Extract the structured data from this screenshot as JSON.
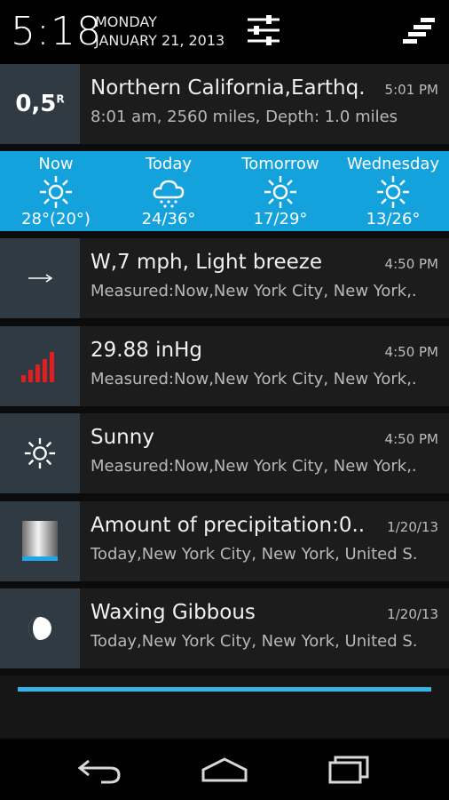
{
  "status": {
    "time": "5:18",
    "day": "MONDAY",
    "date": "JANUARY 21, 2013",
    "settings_icon": "sliders-icon",
    "clear_icon": "clear-all-icon"
  },
  "notifications": [
    {
      "icon": "earthquake-magnitude-icon",
      "icon_text": "0,5",
      "icon_sup": "R",
      "title": "Northern California,Earthq.",
      "time": "5:01 PM",
      "subtitle": "8:01 am, 2560 miles, Depth: 1.0 miles"
    },
    {
      "icon": "wind-arrow-icon",
      "title": "W,7 mph, Light breeze",
      "time": "4:50 PM",
      "subtitle": "Measured:Now,New York City, New York,."
    },
    {
      "icon": "pressure-bars-icon",
      "title": "29.88 inHg",
      "time": "4:50 PM",
      "subtitle": "Measured:Now,New York City, New York,."
    },
    {
      "icon": "sun-icon",
      "title": "Sunny",
      "time": "4:50 PM",
      "subtitle": "Measured:Now,New York City, New York,."
    },
    {
      "icon": "precipitation-gauge-icon",
      "title": "Amount of precipitation:0..",
      "time": "1/20/13",
      "subtitle": "Today,New York City, New York, United S."
    },
    {
      "icon": "moon-phase-icon",
      "title": "Waxing Gibbous",
      "time": "1/20/13",
      "subtitle": "Today,New York City, New York, United S."
    }
  ],
  "forecast": [
    {
      "label": "Now",
      "icon": "sun-icon",
      "temp": "28°(20°)"
    },
    {
      "label": "Today",
      "icon": "snow-cloud-icon",
      "temp": "24/36°"
    },
    {
      "label": "Tomorrow",
      "icon": "sun-icon",
      "temp": "17/29°"
    },
    {
      "label": "Wednesday",
      "icon": "sun-icon",
      "temp": "13/26°"
    }
  ],
  "colors": {
    "accent": "#14a2dd",
    "scrollbar": "#33b5e5",
    "icon_box": "#2f3a42",
    "pressure": "#e02020"
  },
  "navbar": {
    "back_icon": "back-icon",
    "home_icon": "home-icon",
    "recents_icon": "recent-apps-icon"
  }
}
